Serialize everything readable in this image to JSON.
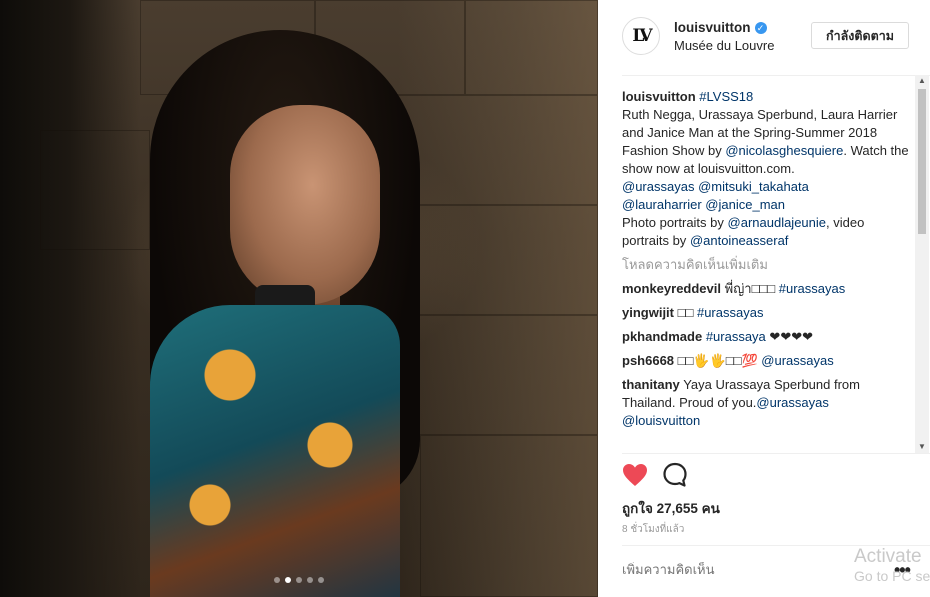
{
  "post": {
    "username": "louisvuitton",
    "verified_icon": "verified-badge-icon",
    "location": "Musée du Louvre",
    "follow_label": "กำลังติดตาม",
    "avatar_text": "LV"
  },
  "carousel": {
    "count": 5,
    "active_index": 1
  },
  "caption": {
    "username": "louisvuitton",
    "hashtag": "#LVSS18",
    "line1": "Ruth Negga, Urassaya Sperbund, Laura Harrier and Janice Man at the Spring-Summer 2018 Fashion Show by",
    "mention1": "@nicolasghesquiere",
    "line2": ". Watch the show now at louisvuitton.com.",
    "mention2": "@urassayas",
    "mention3": "@mitsuki_takahata",
    "mention4": "@lauraharrier",
    "mention5": "@janice_man",
    "line3": "Photo portraits by",
    "mention6": "@arnaudlajeunie",
    "line4": ", video portraits by",
    "mention7": "@antoineasseraf"
  },
  "load_more": "โหลดความคิดเห็นเพิ่มเติม",
  "comments": [
    {
      "user": "monkeyreddevil",
      "text": "พี่ญ่า□□□",
      "tag": "#urassayas"
    },
    {
      "user": "yingwijit",
      "text": "□□",
      "tag": "#urassayas"
    },
    {
      "user": "pkhandmade",
      "text": "",
      "tag": "#urassaya",
      "suffix": "❤❤❤❤"
    },
    {
      "user": "psh6668",
      "text": "□□🖐🖐□□💯",
      "tag": "@urassayas"
    },
    {
      "user": "thanitany",
      "text": "Yaya Urassaya Sperbund from Thailand. Proud of you.",
      "tag": "@urassayas",
      "tag2": "@louisvuitton"
    }
  ],
  "actions": {
    "like_icon": "heart-icon",
    "comment_icon": "comment-icon"
  },
  "likes": "ถูกใจ 27,655 คน",
  "time": "8 ชั่วโมงที่แล้ว",
  "add_comment_placeholder": "เพิ่มความคิดเห็น",
  "more_options": "•••",
  "watermark": {
    "line1": "Activate",
    "line2": "Go to PC se"
  },
  "colors": {
    "link": "#003569",
    "heart": "#ed4956",
    "verified": "#3897f0"
  }
}
